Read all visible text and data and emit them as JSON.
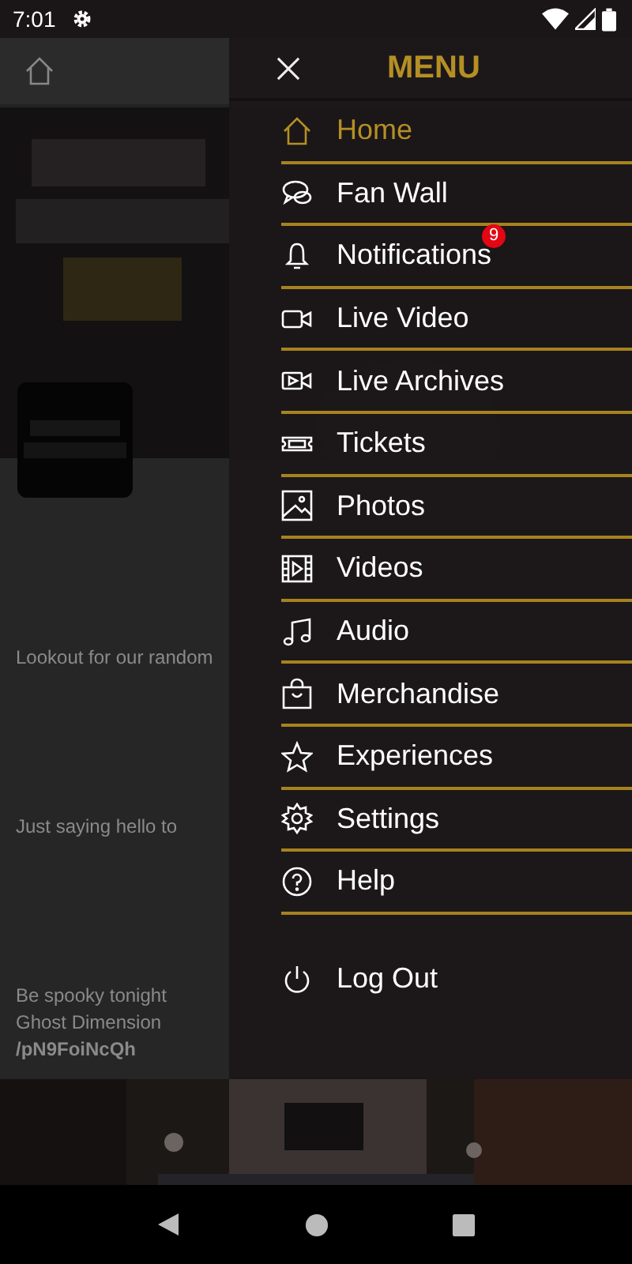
{
  "status_bar": {
    "time": "7:01"
  },
  "background": {
    "posts": [
      {
        "lines": [
          "Lookout for our random"
        ]
      },
      {
        "lines": [
          "Just saying hello to"
        ]
      },
      {
        "lines": [
          "Be spooky tonight",
          "Ghost Dimension",
          "**/pN9FoiNcQh**"
        ]
      }
    ]
  },
  "drawer": {
    "title": "MENU",
    "items": [
      {
        "label": "Home",
        "selected": true
      },
      {
        "label": "Fan Wall",
        "selected": false
      },
      {
        "label": "Notifications",
        "selected": false,
        "badge": "9"
      },
      {
        "label": "Live Video",
        "selected": false
      },
      {
        "label": "Live Archives",
        "selected": false
      },
      {
        "label": "Tickets",
        "selected": false
      },
      {
        "label": "Photos",
        "selected": false
      },
      {
        "label": "Videos",
        "selected": false
      },
      {
        "label": "Audio",
        "selected": false
      },
      {
        "label": "Merchandise",
        "selected": false
      },
      {
        "label": "Experiences",
        "selected": false
      },
      {
        "label": "Settings",
        "selected": false
      },
      {
        "label": "Help",
        "selected": false
      }
    ],
    "footer_item": {
      "label": "Log Out"
    }
  }
}
